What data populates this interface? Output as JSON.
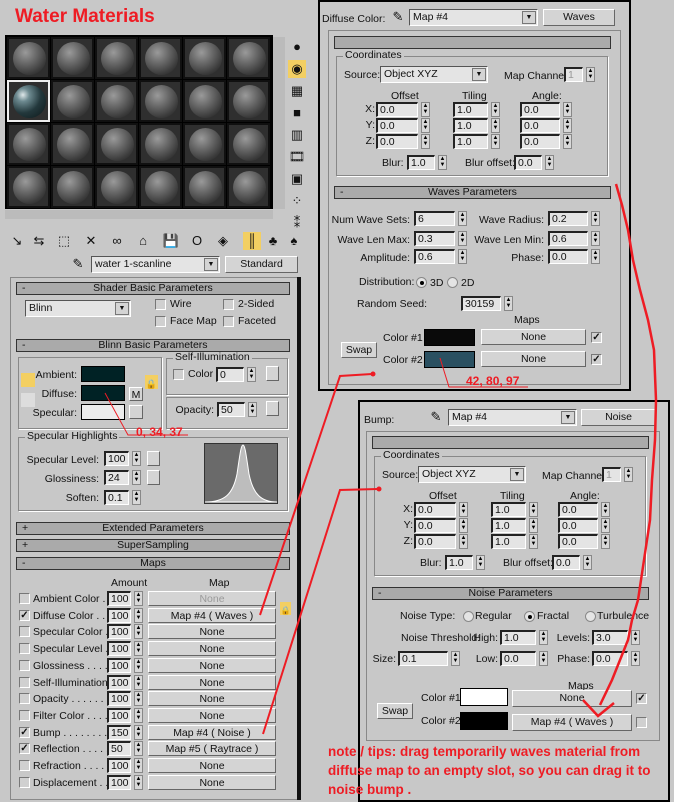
{
  "title": "Water Materials",
  "slots": {
    "count": 24,
    "active_index": 6
  },
  "side_toolbar": [
    "sample-type-icon",
    "backlight-icon",
    "background-checker-icon",
    "sample-uv-tiling-icon",
    "video-color-check-icon",
    "make-preview-icon",
    "options-icon",
    "select-by-material-icon",
    "material-map-navigator-icon"
  ],
  "toolbar": [
    "get-material-icon",
    "put-to-scene-icon",
    "assign-to-selection-icon",
    "reset-map-icon",
    "make-unique-icon",
    "put-to-library-icon",
    "material-effects-channel-icon",
    "show-map-in-viewport-icon",
    "show-end-result-icon",
    "go-to-parent-icon",
    "go-forward-to-sibling-icon",
    "pick-material-icon"
  ],
  "material": {
    "name": "water 1-scanline",
    "type": "Standard"
  },
  "shader": {
    "header": "Shader Basic Parameters",
    "sign": "-",
    "shader": "Blinn",
    "wire": {
      "label": "Wire",
      "checked": false
    },
    "two_sided": {
      "label": "2-Sided",
      "checked": false
    },
    "face_map": {
      "label": "Face Map",
      "checked": false
    },
    "faceted": {
      "label": "Faceted",
      "checked": false
    }
  },
  "blinn": {
    "header": "Blinn Basic Parameters",
    "sign": "-",
    "ambient_label": "Ambient:",
    "diffuse_label": "Diffuse:",
    "specular_label": "Specular:",
    "ambient_color": "#002225",
    "diffuse_color": "#002225",
    "specular_color": "#ececec",
    "m_label": "M",
    "self_illum": {
      "legend": "Self-Illumination",
      "color_label": "Color",
      "checked": false,
      "value": "0"
    },
    "opacity": {
      "label": "Opacity:",
      "value": "50"
    },
    "spec": {
      "legend": "Specular Highlights",
      "level_label": "Specular Level:",
      "level": "100",
      "gloss_label": "Glossiness:",
      "gloss": "24",
      "soften_label": "Soften:",
      "soften": "0.1"
    }
  },
  "extended": {
    "header": "Extended Parameters",
    "sign": "+"
  },
  "supersampling": {
    "header": "SuperSampling",
    "sign": "+"
  },
  "maps": {
    "header": "Maps",
    "sign": "-",
    "amount_header": "Amount",
    "map_header": "Map",
    "rows": [
      {
        "label": "Ambient Color . . .",
        "checked": false,
        "amount": "100",
        "map": "None",
        "disabled": true
      },
      {
        "label": "Diffuse Color . . . .",
        "checked": true,
        "amount": "100",
        "map": "Map #4  ( Waves )"
      },
      {
        "label": "Specular Color  . .",
        "checked": false,
        "amount": "100",
        "map": "None"
      },
      {
        "label": "Specular Level  .",
        "checked": false,
        "amount": "100",
        "map": "None"
      },
      {
        "label": "Glossiness . . . . .",
        "checked": false,
        "amount": "100",
        "map": "None"
      },
      {
        "label": "Self-Illumination .",
        "checked": false,
        "amount": "100",
        "map": "None"
      },
      {
        "label": "Opacity . . . . . . . .",
        "checked": false,
        "amount": "100",
        "map": "None"
      },
      {
        "label": "Filter Color . . . . .",
        "checked": false,
        "amount": "100",
        "map": "None"
      },
      {
        "label": "Bump . . . . . . . . .",
        "checked": true,
        "amount": "150",
        "map": "Map #4  ( Noise )"
      },
      {
        "label": "Reflection . . . . .",
        "checked": true,
        "amount": "50",
        "map": "Map #5  ( Raytrace )"
      },
      {
        "label": "Refraction . . . . . .",
        "checked": false,
        "amount": "100",
        "map": "None"
      },
      {
        "label": "Displacement . . . .",
        "checked": false,
        "amount": "100",
        "map": "None"
      }
    ]
  },
  "waves_panel": {
    "slot_label": "Diffuse Color:",
    "map_name": "Map #4",
    "map_type": "Waves",
    "coords": {
      "header": "Coordinates",
      "sign": "-",
      "legend": "Coordinates",
      "source_label": "Source:",
      "source": "Object XYZ",
      "channel_label": "Map Channel:",
      "channel": "1",
      "offset_label": "Offset",
      "tiling_label": "Tiling",
      "angle_label": "Angle:",
      "axes": [
        "X:",
        "Y:",
        "Z:"
      ],
      "offset": [
        "0.0",
        "0.0",
        "0.0"
      ],
      "tiling": [
        "1.0",
        "1.0",
        "1.0"
      ],
      "angle": [
        "0.0",
        "0.0",
        "0.0"
      ],
      "blur_label": "Blur:",
      "blur": "1.0",
      "blur_offset_label": "Blur offset:",
      "blur_offset": "0.0"
    },
    "params": {
      "header": "Waves Parameters",
      "sign": "-",
      "num_sets_label": "Num Wave Sets:",
      "num_sets": "6",
      "radius_label": "Wave Radius:",
      "radius": "0.2",
      "len_max_label": "Wave Len Max:",
      "len_max": "0.3",
      "len_min_label": "Wave Len Min:",
      "len_min": "0.6",
      "amplitude_label": "Amplitude:",
      "amplitude": "0.6",
      "phase_label": "Phase:",
      "phase": "0.0",
      "distribution_label": "Distribution:",
      "dist_3d": "3D",
      "dist_2d": "2D",
      "distribution": "3D",
      "seed_label": "Random Seed:",
      "seed": "30159",
      "maps_label": "Maps",
      "swap": "Swap",
      "color1_label": "Color #1",
      "color1": "#0a0a0a",
      "map1": "None",
      "map1_on": true,
      "color2_label": "Color #2",
      "color2": "#2a5061",
      "map2": "None",
      "map2_on": true
    }
  },
  "noise_panel": {
    "slot_label": "Bump:",
    "map_name": "Map #4",
    "map_type": "Noise",
    "coords": {
      "header": "Coordinates",
      "sign": "-",
      "legend": "Coordinates",
      "source_label": "Source:",
      "source": "Object XYZ",
      "channel_label": "Map Channel:",
      "channel": "1",
      "offset_label": "Offset",
      "tiling_label": "Tiling",
      "angle_label": "Angle:",
      "axes": [
        "X:",
        "Y:",
        "Z:"
      ],
      "offset": [
        "0.0",
        "0.0",
        "0.0"
      ],
      "tiling": [
        "1.0",
        "1.0",
        "1.0"
      ],
      "angle": [
        "0.0",
        "0.0",
        "0.0"
      ],
      "blur_label": "Blur:",
      "blur": "1.0",
      "blur_offset_label": "Blur offset:",
      "blur_offset": "0.0"
    },
    "params": {
      "header": "Noise Parameters",
      "sign": "-",
      "type_label": "Noise Type:",
      "regular": "Regular",
      "fractal": "Fractal",
      "turbulence": "Turbulence",
      "type": "Fractal",
      "threshold_label": "Noise Threshold:",
      "high_label": "High:",
      "high": "1.0",
      "levels_label": "Levels:",
      "levels": "3.0",
      "size_label": "Size:",
      "size": "0.1",
      "low_label": "Low:",
      "low": "0.0",
      "phase_label": "Phase:",
      "phase": "0.0",
      "maps_label": "Maps",
      "swap": "Swap",
      "color1_label": "Color #1",
      "color1": "#ffffff",
      "map1": "None",
      "map1_on": true,
      "color2_label": "Color #2",
      "color2": "#000000",
      "map2": "Map #4  ( Waves )",
      "map2_on": false
    }
  },
  "annotations": {
    "diffuse_rgb": "0, 34, 37",
    "color2_rgb": "42, 80, 97",
    "note": [
      "note / tips: drag temporarily waves material from",
      "diffuse map to an empty slot, so you can drag it to",
      "noise bump ."
    ],
    "accent": "#ee1c24"
  }
}
